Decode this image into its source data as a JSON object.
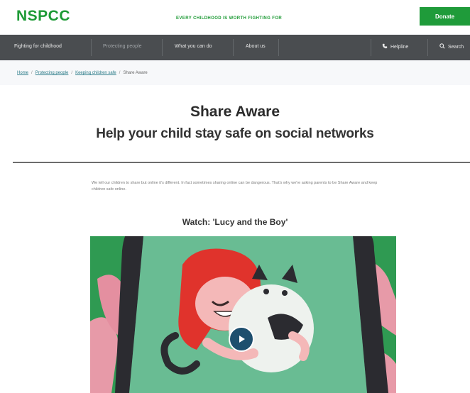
{
  "header": {
    "logo": "NSPCC",
    "tagline": "EVERY CHILDHOOD IS WORTH FIGHTING FOR",
    "donate_label": "Donate"
  },
  "nav": {
    "items": [
      {
        "label": "Fighting for childhood"
      },
      {
        "label": "Protecting people"
      },
      {
        "label": "What you can do"
      },
      {
        "label": "About us"
      }
    ],
    "helpline_label": "Helpline",
    "search_label": "Search"
  },
  "breadcrumb": {
    "items": [
      "Home",
      "Protecting people",
      "Keeping children safe",
      "Share Aware"
    ]
  },
  "main": {
    "title": "Share Aware",
    "subtitle": "Help your child stay safe on social networks",
    "intro": "We tell our children to share but online it's different. In fact sometimes sharing online can be dangerous. That's why we're asking parents to be Share Aware and keep children safe online.",
    "video_heading": "Watch: 'Lucy and the Boy'"
  },
  "colors": {
    "brand_green": "#1d9a35",
    "nav_bg": "#4a4d50",
    "video_bg": "#2f9a52"
  }
}
